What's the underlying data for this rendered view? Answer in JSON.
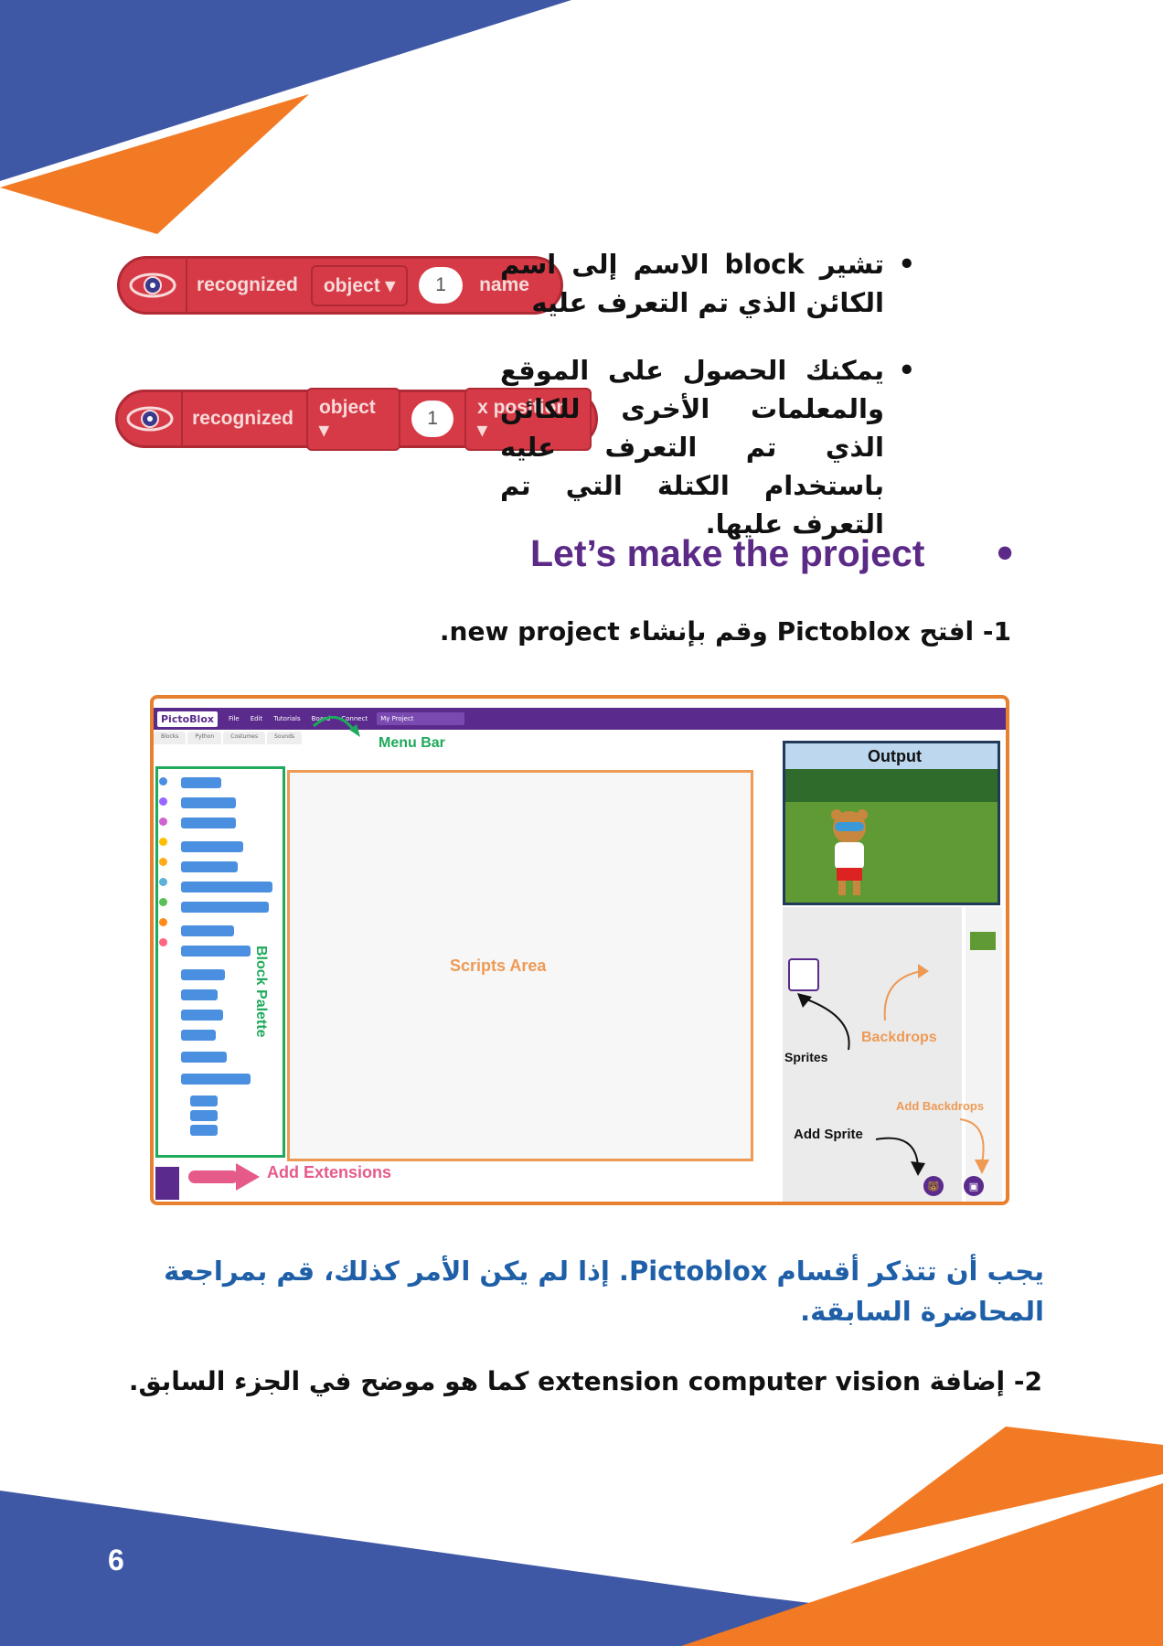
{
  "colors": {
    "blue": "#3f58a5",
    "orange": "#f27a24",
    "purple": "#5b2a86",
    "note_blue": "#1e5fa8",
    "block_red": "#d63a46"
  },
  "bullets": [
    "تشير block الاسم إلى اسم الكائن الذي تم التعرف عليه",
    "يمكنك الحصول على الموقع والمعلمات الأخرى للكائن الذي تم التعرف عليه باستخدام الكتلة التي تم التعرف عليها."
  ],
  "blocks": [
    {
      "label": "recognized",
      "dropdown": "object",
      "number": "1",
      "field": "name",
      "icon": "eye-icon"
    },
    {
      "label": "recognized",
      "dropdown": "object",
      "number": "1",
      "field": "x position",
      "icon": "eye-icon"
    }
  ],
  "heading": "Let’s make the project",
  "step1": "1- افتح Pictoblox وقم بإنشاء new project.",
  "screenshot": {
    "logo": "PictoBlox",
    "menu_items": [
      "File",
      "Edit",
      "Tutorials",
      "Board",
      "Connect"
    ],
    "project_name": "My Project",
    "tabs": [
      "Blocks",
      "Python",
      "Costumes",
      "Sounds"
    ],
    "labels": {
      "menu_bar": "Menu Bar",
      "block_palette": "Block Palette",
      "scripts_area": "Scripts Area",
      "output": "Output",
      "sprites": "Sprites",
      "backdrops": "Backdrops",
      "add_backdrops": "Add Backdrops",
      "add_sprite": "Add Sprite",
      "add_extensions": "Add Extensions"
    }
  },
  "note": "يجب أن تتذكر أقسام Pictoblox. إذا لم يكن الأمر كذلك، قم بمراجعة المحاضرة السابقة.",
  "step2": "2- إضافة extension computer vision كما هو موضح في الجزء السابق.",
  "page_number": "6"
}
